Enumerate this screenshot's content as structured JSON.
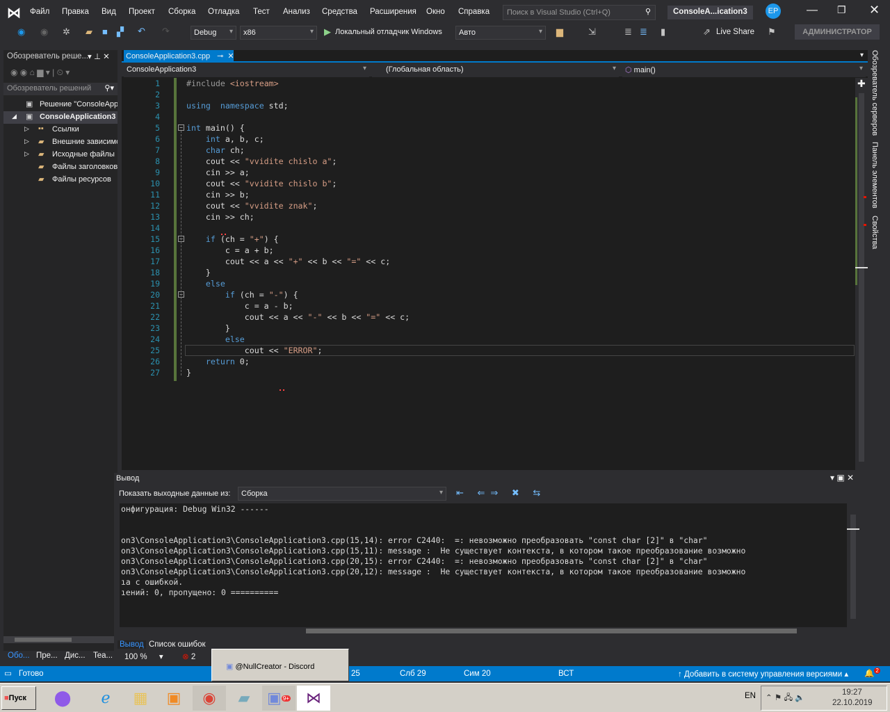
{
  "menubar": {
    "items": [
      "Файл",
      "Правка",
      "Вид",
      "Проект",
      "Сборка",
      "Отладка",
      "Тест",
      "Анализ",
      "Средства",
      "Расширения",
      "Окно",
      "Справка"
    ],
    "search_placeholder": "Поиск в Visual Studio (Ctrl+Q)",
    "window_title": "ConsoleA...ication3",
    "avatar": "EP"
  },
  "toolbar": {
    "config": "Debug",
    "platform": "x86",
    "run_label": "Локальный отладчик Windows",
    "run_mode": "Авто",
    "live_share": "Live Share",
    "admin": "АДМИНИСТРАТОР"
  },
  "solution_explorer": {
    "title": "Обозреватель реше...",
    "search_placeholder": "Обозреватель решений",
    "items": [
      {
        "label": "Решение \"ConsoleApplicati",
        "level": 0
      },
      {
        "label": "ConsoleApplication3",
        "level": 1,
        "bold": true
      },
      {
        "label": "Ссылки",
        "level": 2,
        "expander": true
      },
      {
        "label": "Внешние зависимо",
        "level": 2,
        "expander": true
      },
      {
        "label": "Исходные файлы",
        "level": 2,
        "expander": true
      },
      {
        "label": "Файлы заголовков",
        "level": 2
      },
      {
        "label": "Файлы ресурсов",
        "level": 2
      }
    ],
    "bottom_tabs": [
      "Обо...",
      "Пре...",
      "Дис...",
      "Tea..."
    ]
  },
  "editor": {
    "tab": "ConsoleApplication3.cpp",
    "nav_project": "ConsoleApplication3",
    "nav_scope": "(Глобальная область)",
    "nav_member": "main()",
    "lines": [
      [
        [
          "pp",
          "#include "
        ],
        [
          "ang",
          "<iostream>"
        ]
      ],
      [],
      [
        [
          "kw",
          "using"
        ],
        [
          "",
          "  "
        ],
        [
          "kw",
          "namespace"
        ],
        [
          "",
          " std;"
        ]
      ],
      [],
      [
        [
          "kw",
          "int"
        ],
        [
          "",
          " main() {"
        ]
      ],
      [
        [
          "",
          "    "
        ],
        [
          "kw",
          "int"
        ],
        [
          "",
          " a, b, c;"
        ]
      ],
      [
        [
          "",
          "    "
        ],
        [
          "kw",
          "char"
        ],
        [
          "",
          " ch;"
        ]
      ],
      [
        [
          "",
          "    cout << "
        ],
        [
          "st",
          "\"vvidite chislo a\""
        ],
        [
          "",
          ";"
        ]
      ],
      [
        [
          "",
          "    cin >> a;"
        ]
      ],
      [
        [
          "",
          "    cout << "
        ],
        [
          "st",
          "\"vvidite chislo b\""
        ],
        [
          "",
          ";"
        ]
      ],
      [
        [
          "",
          "    cin >> b;"
        ]
      ],
      [
        [
          "",
          "    cout << "
        ],
        [
          "st",
          "\"vvidite znak\""
        ],
        [
          "",
          ";"
        ]
      ],
      [
        [
          "",
          "    cin >> ch;"
        ]
      ],
      [],
      [
        [
          "",
          "    "
        ],
        [
          "kw",
          "if"
        ],
        [
          "",
          " (ch = "
        ],
        [
          "st",
          "\"+\""
        ],
        [
          "",
          ") {"
        ]
      ],
      [
        [
          "",
          "        c = a + b;"
        ]
      ],
      [
        [
          "",
          "        cout << a << "
        ],
        [
          "st",
          "\"+\""
        ],
        [
          "",
          " << b << "
        ],
        [
          "st",
          "\"=\""
        ],
        [
          "",
          " << c;"
        ]
      ],
      [
        [
          "",
          "    }"
        ]
      ],
      [
        [
          "",
          "    "
        ],
        [
          "kw",
          "else"
        ]
      ],
      [
        [
          "",
          "        "
        ],
        [
          "kw",
          "if"
        ],
        [
          "",
          " (ch = "
        ],
        [
          "st",
          "\"-\""
        ],
        [
          "",
          ") {"
        ]
      ],
      [
        [
          "",
          "            c = a - b;"
        ]
      ],
      [
        [
          "",
          "            cout << a << "
        ],
        [
          "st",
          "\"-\""
        ],
        [
          "",
          " << b << "
        ],
        [
          "st",
          "\"=\""
        ],
        [
          "",
          " << c;"
        ]
      ],
      [
        [
          "",
          "        }"
        ]
      ],
      [
        [
          "",
          "        "
        ],
        [
          "kw",
          "else"
        ]
      ],
      [
        [
          "",
          "            cout << "
        ],
        [
          "st",
          "\"ERROR\""
        ],
        [
          "",
          ";"
        ]
      ],
      [
        [
          "",
          "    "
        ],
        [
          "kw",
          "return"
        ],
        [
          "",
          " 0;"
        ]
      ],
      [
        [
          "",
          "}"
        ]
      ]
    ]
  },
  "right_tabs": [
    "Обозреватель серверов",
    "Панель элементов",
    "Свойства"
  ],
  "output": {
    "title": "Вывод",
    "show_from_label": "Показать выходные данные из:",
    "source": "Сборка",
    "lines": [
      "онфигурация: Debug Win32 ------",
      "",
      "on3\\ConsoleApplication3\\ConsoleApplication3.cpp(15,14): error C2440:  =: невозможно преобразовать \"const char [2]\" в \"char\"",
      "on3\\ConsoleApplication3\\ConsoleApplication3.cpp(15,11): message :  Не существует контекста, в котором такое преобразование возможно",
      "on3\\ConsoleApplication3\\ConsoleApplication3.cpp(20,15): error C2440:  =: невозможно преобразовать \"const char [2]\" в \"char\"",
      "on3\\ConsoleApplication3\\ConsoleApplication3.cpp(20,12): message :  Не существует контекста, в котором такое преобразование возможно",
      "ıa с ошибкой.",
      "ıений: 0, пропущено: 0 =========="
    ],
    "tabs": [
      "Вывод",
      "Список ошибок"
    ],
    "zoom": "100 %",
    "errors": "2"
  },
  "status": {
    "ready": "Готово",
    "line": "25",
    "col": "Слб 29",
    "char": "Сим 20",
    "mode": "ВСТ",
    "vcs": "Добавить в систему управления версиями",
    "notifications": "2"
  },
  "popup": {
    "label": "@NullCreator - Discord"
  },
  "taskbar": {
    "start": "Пуск",
    "lang": "EN",
    "time": "19:27",
    "date": "22.10.2019",
    "discord_badge": "9+"
  }
}
